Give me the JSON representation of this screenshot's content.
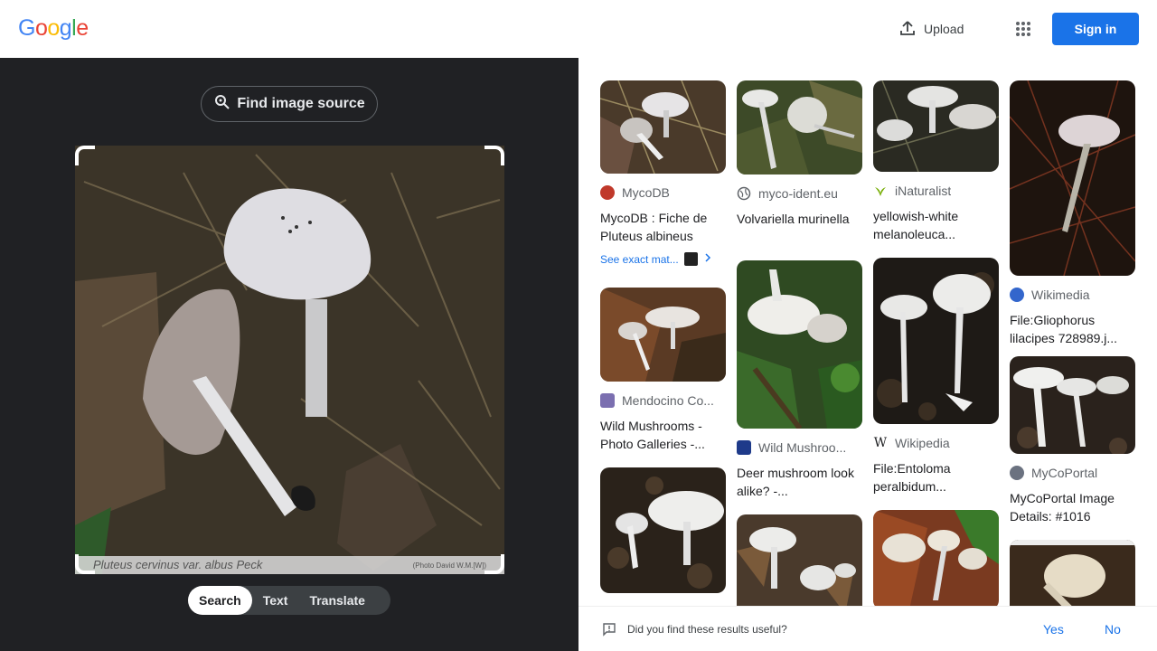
{
  "header": {
    "logo_letters": [
      "G",
      "o",
      "o",
      "g",
      "l",
      "e"
    ],
    "logo_colors": [
      "#4285F4",
      "#EA4335",
      "#FBBC05",
      "#4285F4",
      "#34A853",
      "#EA4335"
    ],
    "upload_label": "Upload",
    "signin_label": "Sign in"
  },
  "left": {
    "find_source_label": "Find image source",
    "caption_left": "Pluteus cervinus var. albus Peck",
    "caption_right": "(Photo David W.M.[W])",
    "tabs": [
      {
        "label": "Search",
        "active": true
      },
      {
        "label": "Text",
        "active": false
      },
      {
        "label": "Translate",
        "active": false
      }
    ]
  },
  "results": {
    "col1": [
      {
        "source": "MycoDB",
        "title": "MycoDB : Fiche de Pluteus albineus",
        "exact": "See exact mat...",
        "fav_color": "#c0392b",
        "thumb": "grass_brown"
      },
      {
        "source": "Mendocino Co...",
        "title": "Wild Mushrooms - Photo Galleries -...",
        "fav_color": "#7b6fb0",
        "thumb": "leaf_brown"
      },
      {
        "source": "",
        "title": "",
        "fav_color": "",
        "thumb": "dark_soil"
      }
    ],
    "col2": [
      {
        "source": "myco-ident.eu",
        "title": "Volvariella murinella",
        "fav_color": "#5f6368",
        "thumb": "moss_green"
      },
      {
        "source": "Wild Mushroo...",
        "title": "Deer mushroom look alike? -...",
        "fav_color": "#1e3a8a",
        "thumb": "moss_green2"
      },
      {
        "source": "",
        "title": "",
        "fav_color": "",
        "thumb": "forest_floor"
      }
    ],
    "col3": [
      {
        "source": "iNaturalist",
        "title": "yellowish-white melanoleuca...",
        "fav_color": "#74ac00",
        "thumb": "dark_twigs"
      },
      {
        "source": "Wikipedia",
        "title": "File:Entoloma peralbidum...",
        "fav_color": "#ffffff",
        "thumb": "dark_soil2"
      },
      {
        "source": "",
        "title": "",
        "fav_color": "",
        "thumb": "red_leaves"
      }
    ],
    "col4": [
      {
        "source": "Wikimedia",
        "title": "File:Gliophorus lilacipes 728989.j...",
        "fav_color": "#3366cc",
        "thumb": "red_twigs"
      },
      {
        "source": "MyCoPortal",
        "title": "MyCoPortal Image Details: #1016",
        "fav_color": "#6b7280",
        "thumb": "dark_soil3"
      },
      {
        "source": "",
        "title": "",
        "fav_color": "",
        "thumb": "beige_cap"
      }
    ]
  },
  "feedback": {
    "question": "Did you find these results useful?",
    "yes": "Yes",
    "no": "No"
  }
}
